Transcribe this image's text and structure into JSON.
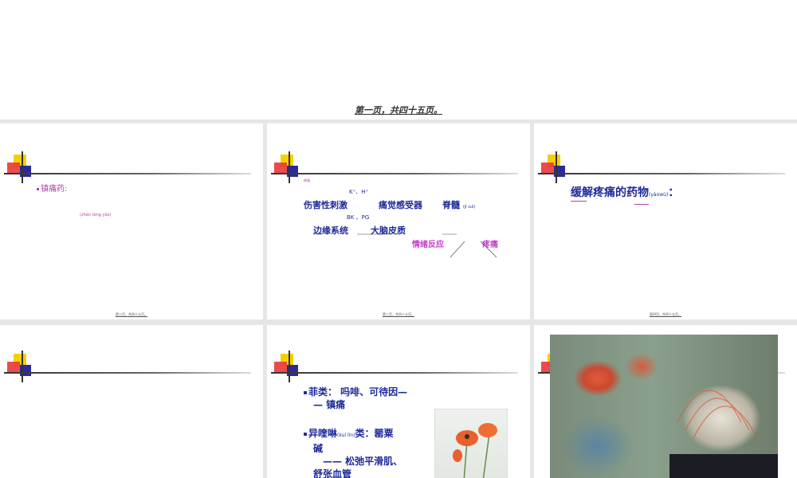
{
  "top": {
    "caption": "第一页，共四十五页。"
  },
  "slide1": {
    "bullet": "镇痛药:",
    "small_line": "(zhèn tònɡ yào)",
    "footer": "第二页，共四十五页。"
  },
  "slide2": {
    "tiny_label": "疼痛",
    "k_h": "K⁺、H⁺",
    "stimulus": "伤害性刺激",
    "receptor": "痛觉感受器",
    "spinal": "脊髓",
    "spinal_pinyin": "(jǐ suǐ)",
    "bk_pg": "BK 、PG",
    "limbic": "边缘系统",
    "cortex": "大脑皮质",
    "emotion": "情绪反应",
    "pain": "疼痛",
    "footer": "第三页，共四十五页。"
  },
  "slide3": {
    "title": "缓解疼痛的药物",
    "title_pinyin": "(yàowù)",
    "colon": "：",
    "footer": "第四页，共四十五页。"
  },
  "slide5": {
    "item1_line1": "菲类：  吗啡、可待因—",
    "item1_line2": "—  镇痛",
    "item2_line1a": "异喹啉",
    "item2_pinyin": "(kuí lín)",
    "item2_line1b": "类：罂粟",
    "item2_line2": "碱",
    "item2_line3": "——  松弛平滑肌、",
    "item2_line4": "舒张血管"
  },
  "colors": {
    "accent_blue": "#1e2a9a",
    "accent_purple": "#b23fa8",
    "accent_magenta": "#c33ccd"
  }
}
